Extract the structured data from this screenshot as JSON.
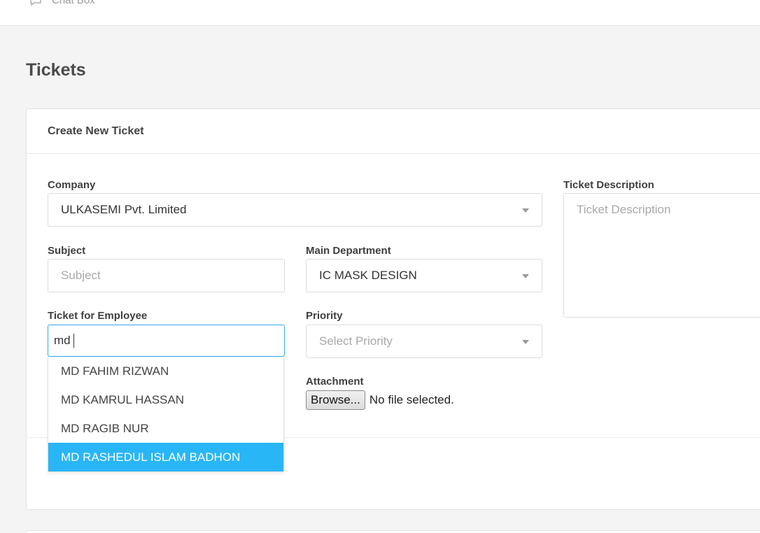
{
  "header": {
    "nav_item_label": "Chat Box",
    "nav_item_icon": "chat-icon"
  },
  "page": {
    "title": "Tickets"
  },
  "card": {
    "title": "Create New Ticket"
  },
  "form": {
    "company": {
      "label": "Company",
      "value": "ULKASEMI Pvt. Limited"
    },
    "subject": {
      "label": "Subject",
      "placeholder": "Subject"
    },
    "main_department": {
      "label": "Main Department",
      "value": "IC MASK DESIGN"
    },
    "ticket_for_employee": {
      "label": "Ticket for Employee",
      "typed_value": "md"
    },
    "priority": {
      "label": "Priority",
      "placeholder": "Select Priority"
    },
    "attachment": {
      "label": "Attachment",
      "button_label": "Browse...",
      "status": "No file selected."
    },
    "ticket_description": {
      "label": "Ticket Description",
      "placeholder": "Ticket Description"
    }
  },
  "employee_suggestions": [
    {
      "label": "MD FAHIM RIZWAN",
      "highlighted": false
    },
    {
      "label": "MD KAMRUL HASSAN",
      "highlighted": false
    },
    {
      "label": "MD RAGIB NUR",
      "highlighted": false
    },
    {
      "label": "MD RASHEDUL ISLAM BADHON",
      "highlighted": true
    }
  ],
  "colors": {
    "accent": "#29b6f6",
    "focus_border": "#2fa8e8",
    "page_bg": "#f4f4f4"
  }
}
